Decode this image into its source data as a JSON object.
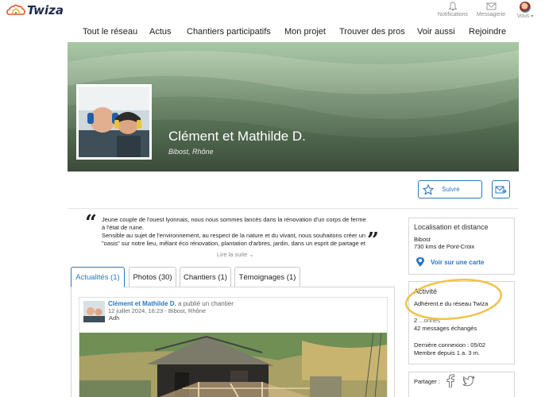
{
  "app": {
    "brand": "Twiza"
  },
  "top_icons": {
    "notifications": "Notifications",
    "messagerie": "Messagerie",
    "vous": "Vous"
  },
  "nav": {
    "items": [
      "Tout le réseau",
      "Actus",
      "Chantiers participatifs",
      "Mon projet",
      "Trouver des pros",
      "Voir aussi",
      "Rejoindre"
    ]
  },
  "profile": {
    "name": "Clément et Mathilde D.",
    "location": "Bibost, Rhône"
  },
  "actions": {
    "follow_label": "Suivre"
  },
  "description": {
    "line1": "Jeune couple de l'ouest lyonnais, nous nous sommes lancés dans la rénovation d'un corps de ferme à l'état de ruine.",
    "line2": "Sensible au sujet de l'environnement, au respect de la nature et du vivant, nous souhaitons créer un \"oasis\" sur notre lieu, mêlant éco rénovation, plantation d'arbres, jardin, dans un esprit de partage et",
    "read_more": "Lire la suite"
  },
  "tabs": [
    {
      "label": "Actualités (1)",
      "active": true
    },
    {
      "label": "Photos (30)",
      "active": false
    },
    {
      "label": "Chantiers (1)",
      "active": false
    },
    {
      "label": "Témoignages (1)",
      "active": false
    }
  ],
  "post": {
    "author": "Clément et Mathilde D.",
    "action": "a publié un chantier",
    "date": "12 juillet 2024, 16:23",
    "place": "Bibost, Rhône",
    "snippet": "Adh"
  },
  "sidebar": {
    "location": {
      "title": "Localisation et distance",
      "town": "Bibost",
      "distance": "730 kms de Pont-Croix",
      "map_link": "Voir sur une carte"
    },
    "activity": {
      "title": "Activité",
      "membership": "Adhérent.e du réseau Twiza",
      "stat1_num": "2",
      "stat1_label": "...onnés",
      "stat2": "42  messages échangés",
      "last_login": "Dernière connexion : 05/02",
      "member_since": "Membre depuis 1 a. 3 m."
    },
    "share": {
      "label": "Partager :"
    }
  },
  "colors": {
    "accent": "#2a78c2",
    "highlight_circle": "#f0c24a",
    "banner": "#9dbf9a"
  }
}
